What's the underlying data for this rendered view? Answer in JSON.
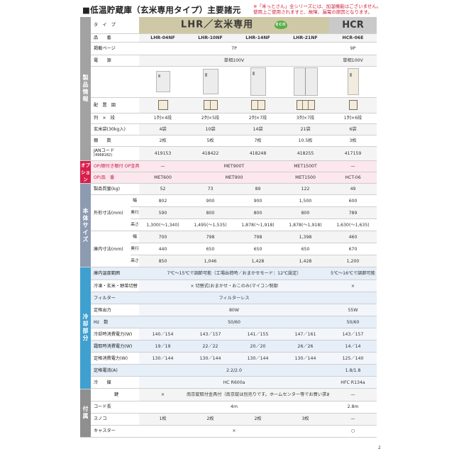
{
  "title": "■低温貯蔵庫（玄米専用タイプ）主要諸元",
  "note": [
    "※「米っとさん」全シリーズには、加湿機能はございません。",
    "使用上ご使用されますと、故障、漏電の原因となります。"
  ],
  "eco_label": "ECO",
  "headers": {
    "type_label": "タ　イ　プ",
    "lhr": "LHR／玄米専用",
    "hcr": "HCR"
  },
  "sections": {
    "product": "製品情報",
    "option": "オプション",
    "body": "本体サイズ",
    "cooling": "冷却部分",
    "accessory": "付属"
  },
  "rows": {
    "model": {
      "label": "品　　番",
      "values": [
        "LHR-04NF",
        "LHR-10NF",
        "LHR-14NF",
        "LHR-21NF",
        "HCR-06E"
      ]
    },
    "page": {
      "label": "掲載ページ",
      "lhr": "7P",
      "hcr": "9P"
    },
    "power": {
      "label": "電　　源",
      "lhr": "単相100V",
      "hcr": "単相100V"
    },
    "layout": {
      "label": "配　置　図"
    },
    "rowsxtiers": {
      "label": "列　×　段",
      "values": [
        "1列×4段",
        "2列×5段",
        "2列×7段",
        "3列×7段",
        "1列×6段"
      ]
    },
    "bags": {
      "label": "玄米袋(30kg入)",
      "values": [
        "4袋",
        "10袋",
        "14袋",
        "21袋",
        "6袋"
      ]
    },
    "shelves": {
      "label": "棚　　数",
      "values": [
        "2枚",
        "5枚",
        "7枚",
        "10.5枚",
        "3枚"
      ]
    },
    "jan": {
      "label": "JANコード",
      "sub": "(4968182)",
      "values": [
        "419153",
        "418422",
        "418248",
        "418255",
        "417159"
      ]
    },
    "opt_mount": {
      "label": "OP/棚付き棚付 OP金具",
      "values": [
        "—",
        "MET900T",
        "MET1500T",
        "—"
      ]
    },
    "opt": {
      "label": "OP/品　番",
      "values": [
        "MET600",
        "MET900",
        "MET1500",
        "HCT-06"
      ]
    },
    "weight": {
      "label": "製品質量(kg)",
      "values": [
        "52",
        "73",
        "89",
        "122",
        "49"
      ]
    },
    "ext_w": {
      "label": "幅",
      "values": [
        "802",
        "900",
        "900",
        "1,500",
        "600"
      ]
    },
    "ext_d": {
      "label": "奥行",
      "values": [
        "590",
        "800",
        "800",
        "800",
        "789"
      ]
    },
    "ext_h": {
      "label": "高さ",
      "values": [
        "1,300(〜1,340)",
        "1,495(〜1,535)",
        "1,878(〜1,918)",
        "1,878(〜1,918)",
        "1,630(〜1,635)"
      ]
    },
    "ext_label": "外形寸法(mm)",
    "int_w": {
      "label": "幅",
      "values": [
        "700",
        "798",
        "798",
        "1,398",
        "460"
      ]
    },
    "int_d": {
      "label": "奥行",
      "values": [
        "440",
        "650",
        "650",
        "650",
        "670"
      ]
    },
    "int_h": {
      "label": "高さ",
      "values": [
        "850",
        "1,046",
        "1,428",
        "1,428",
        "1,200"
      ]
    },
    "int_label": "庫内寸法(mm)",
    "temp": {
      "label": "庫内温度範囲",
      "lhr": "7℃〜15℃で調節可能（工場出荷時／おまかせモード：12℃設定）",
      "hcr": "5℃〜16℃で調節可能"
    },
    "ctrl": {
      "label": "冷凍・玄米・野菜切替",
      "lhr": "×  切替式(おまかせ・おこのみ)マイコン制御",
      "hcr": "×"
    },
    "filter": {
      "label": "フィルター",
      "lhr": "フィルターレス",
      "hcr": ""
    },
    "output": {
      "label": "定格出力",
      "lhr": "80W",
      "hcr": "55W"
    },
    "hz": {
      "label": "Hz　数",
      "lhr": "50/60",
      "hcr": "50/60"
    },
    "pc1": {
      "label": "冷却時消費電力(W)",
      "values": [
        "140／154",
        "143／157",
        "141／155",
        "147／161",
        "143／157"
      ]
    },
    "pc2": {
      "label": "霜取時消費電力(W)",
      "values": [
        "19／19",
        "22／22",
        "20／20",
        "26／26",
        "14／14"
      ]
    },
    "pc3": {
      "label": "定格消費電力(W)",
      "values": [
        "130／144",
        "130／144",
        "130／144",
        "130／144",
        "125／140"
      ]
    },
    "current": {
      "label": "定格電流(A)",
      "lhr": "2.2/2.0",
      "hcr": "1.8/1.8"
    },
    "refrig": {
      "label": "冷　　媒",
      "lhr": "HC R600a",
      "hcr": "HFC R134a"
    },
    "key": {
      "label": "鍵",
      "values": [
        "×",
        "南京錠取付金具付（南京錠は別売りです。ホームセンター等でお買い求めください）",
        "—"
      ]
    },
    "cord": {
      "label": "コード長",
      "lhr": "4m",
      "hcr": "2.8m"
    },
    "sunoko": {
      "label": "スノコ",
      "values": [
        "1枚",
        "2枚",
        "2枚",
        "3枚",
        "—"
      ]
    },
    "caster": {
      "label": "キャスター",
      "lhr": "×",
      "hcr": "○"
    }
  },
  "page_marker": "2"
}
